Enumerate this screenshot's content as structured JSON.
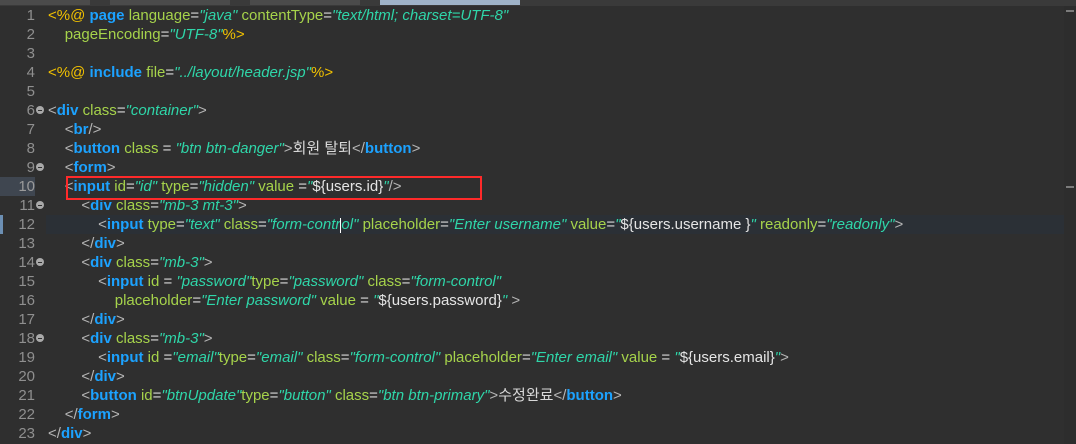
{
  "editor": {
    "lines": [
      {
        "n": "1",
        "c": "<%@ page language=\"java\" contentType=\"text/html; charset=UTF-8\""
      },
      {
        "n": "2",
        "c": "    pageEncoding=\"UTF-8\"%>"
      },
      {
        "n": "3",
        "c": ""
      },
      {
        "n": "4",
        "c": "<%@ include file=\"../layout/header.jsp\"%>"
      },
      {
        "n": "5",
        "c": ""
      },
      {
        "n": "6",
        "c": "<div class=\"container\">"
      },
      {
        "n": "7",
        "c": "    <br/>"
      },
      {
        "n": "8",
        "c": "    <button class = \"btn btn-danger\">회원 탈퇴</button>"
      },
      {
        "n": "9",
        "c": "    <form>"
      },
      {
        "n": "10",
        "c": "    <input id=\"id\" type=\"hidden\" value =\"${users.id}\"/>"
      },
      {
        "n": "11",
        "c": "        <div class=\"mb-3 mt-3\">"
      },
      {
        "n": "12",
        "c": "            <input type=\"text\" class=\"form-control\" placeholder=\"Enter username\" value=\"${users.username }\" readonly=\"readonly\">"
      },
      {
        "n": "13",
        "c": "        </div>"
      },
      {
        "n": "14",
        "c": "        <div class=\"mb-3\">"
      },
      {
        "n": "15",
        "c": "            <input id = \"password\"type=\"password\" class=\"form-control\""
      },
      {
        "n": "16",
        "c": "                placeholder=\"Enter password\" value = \"${users.password}\" >"
      },
      {
        "n": "17",
        "c": "        </div>"
      },
      {
        "n": "18",
        "c": "        <div class=\"mb-3\">"
      },
      {
        "n": "19",
        "c": "            <input id =\"email\"type=\"email\" class=\"form-control\" placeholder=\"Enter email\" value = \"${users.email}\">"
      },
      {
        "n": "20",
        "c": "        </div>"
      },
      {
        "n": "21",
        "c": "        <button id=\"btnUpdate\"type=\"button\" class=\"btn btn-primary\">수정완료</button>"
      },
      {
        "n": "22",
        "c": "    </form>"
      },
      {
        "n": "23",
        "c": "</div>"
      }
    ]
  },
  "colors": {
    "background": "#2f2f2f",
    "keyword": "#1ca2ff",
    "attribute": "#a6d34b",
    "string": "#2fd6a9",
    "jsp_delimiter": "#f2c100",
    "highlight_box": "#ff2a2a"
  }
}
